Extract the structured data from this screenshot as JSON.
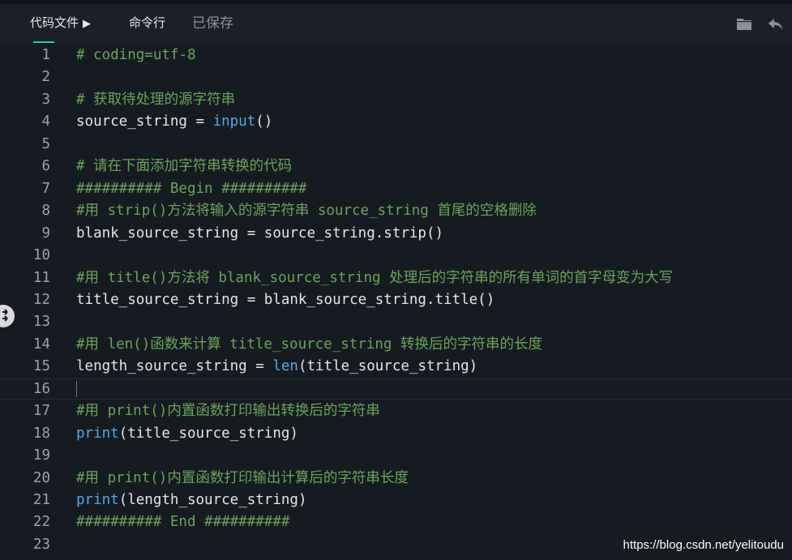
{
  "toolbar": {
    "code_tab_label": "代码文件",
    "code_tab_arrow": "▶",
    "cmd_tab_label": "命令行",
    "save_status": "已保存",
    "folder_icon": "folder-icon",
    "undo_icon": "undo-icon"
  },
  "colors": {
    "background": "#161b22",
    "toolbar": "#1b2028",
    "accent": "#2ecc9a",
    "comment": "#69a45a",
    "builtin": "#58a6e8",
    "text": "#e6e6e6",
    "line_number": "#9aa3ad"
  },
  "editor": {
    "current_line": 16,
    "lines": [
      {
        "n": "1",
        "tokens": [
          {
            "t": "# coding=utf-8",
            "k": "comment"
          }
        ]
      },
      {
        "n": "2",
        "tokens": []
      },
      {
        "n": "3",
        "tokens": [
          {
            "t": "# 获取待处理的源字符串",
            "k": "comment"
          }
        ]
      },
      {
        "n": "4",
        "tokens": [
          {
            "t": "source_string = ",
            "k": "default"
          },
          {
            "t": "input",
            "k": "builtin"
          },
          {
            "t": "()",
            "k": "default"
          }
        ]
      },
      {
        "n": "5",
        "tokens": []
      },
      {
        "n": "6",
        "tokens": [
          {
            "t": "# 请在下面添加字符串转换的代码",
            "k": "comment"
          }
        ]
      },
      {
        "n": "7",
        "tokens": [
          {
            "t": "########## Begin ##########",
            "k": "comment"
          }
        ]
      },
      {
        "n": "8",
        "tokens": [
          {
            "t": "#用 strip()方法将输入的源字符串 source_string 首尾的空格删除",
            "k": "comment"
          }
        ]
      },
      {
        "n": "9",
        "tokens": [
          {
            "t": "blank_source_string = source_string.strip()",
            "k": "default"
          }
        ]
      },
      {
        "n": "10",
        "tokens": []
      },
      {
        "n": "11",
        "tokens": [
          {
            "t": "#用 title()方法将 blank_source_string 处理后的字符串的所有单词的首字母变为大写",
            "k": "comment"
          }
        ]
      },
      {
        "n": "12",
        "tokens": [
          {
            "t": "title_source_string = blank_source_string.title()",
            "k": "default"
          }
        ]
      },
      {
        "n": "13",
        "tokens": []
      },
      {
        "n": "14",
        "tokens": [
          {
            "t": "#用 len()函数来计算 title_source_string 转换后的字符串的长度",
            "k": "comment"
          }
        ]
      },
      {
        "n": "15",
        "tokens": [
          {
            "t": "length_source_string = ",
            "k": "default"
          },
          {
            "t": "len",
            "k": "builtin"
          },
          {
            "t": "(title_source_string)",
            "k": "default"
          }
        ]
      },
      {
        "n": "16",
        "tokens": []
      },
      {
        "n": "17",
        "tokens": [
          {
            "t": "#用 print()内置函数打印输出转换后的字符串",
            "k": "comment"
          }
        ]
      },
      {
        "n": "18",
        "tokens": [
          {
            "t": "print",
            "k": "builtin"
          },
          {
            "t": "(title_source_string)",
            "k": "default"
          }
        ]
      },
      {
        "n": "19",
        "tokens": []
      },
      {
        "n": "20",
        "tokens": [
          {
            "t": "#用 print()内置函数打印输出计算后的字符串长度",
            "k": "comment"
          }
        ]
      },
      {
        "n": "21",
        "tokens": [
          {
            "t": "print",
            "k": "builtin"
          },
          {
            "t": "(length_source_string)",
            "k": "default"
          }
        ]
      },
      {
        "n": "22",
        "tokens": [
          {
            "t": "########## End ##########",
            "k": "comment"
          }
        ]
      },
      {
        "n": "23",
        "tokens": []
      }
    ]
  },
  "watermark": "https://blog.csdn.net/yelitoudu"
}
